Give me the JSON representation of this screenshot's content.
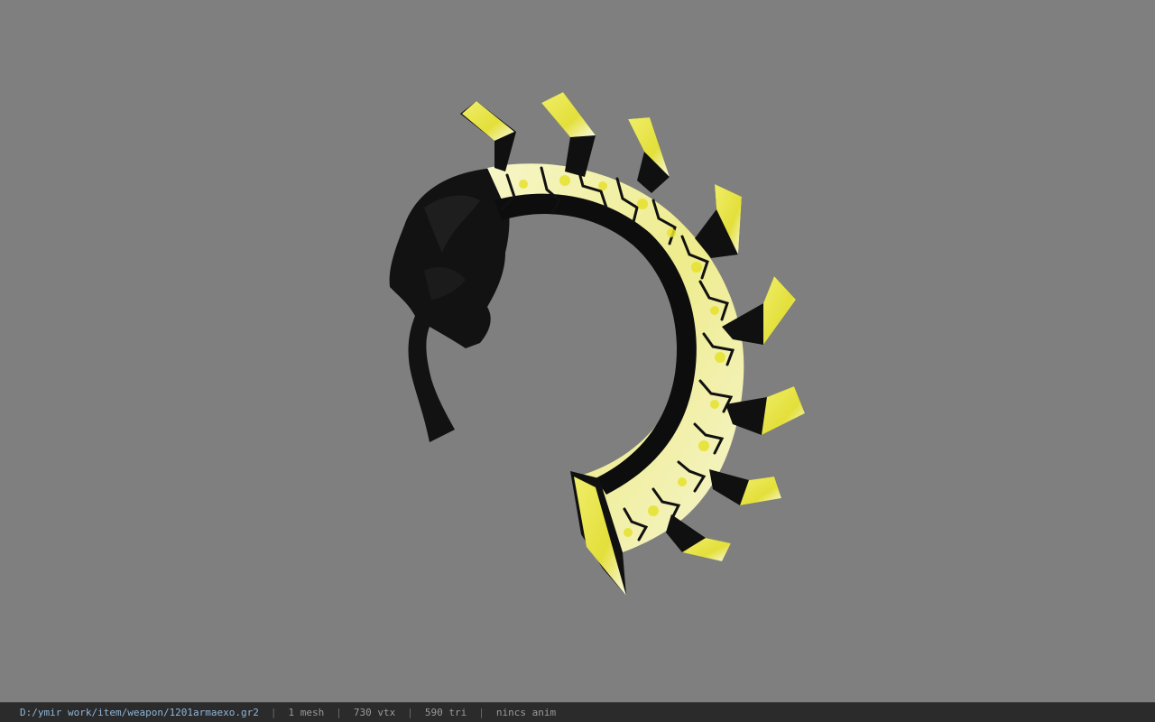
{
  "viewport": {
    "background": "#7f7f7f",
    "model": {
      "description": "yellow-and-black spiked crescent claw weapon",
      "colors": {
        "blade_light": "#f4f3c0",
        "blade_yellow": "#e8e54a",
        "edge_dark": "#0d0d0d",
        "cape_black": "#141414"
      }
    }
  },
  "status": {
    "file_path": "D:/ymir work/item/weapon/1201armaexo.gr2",
    "separator": "|",
    "mesh": "1 mesh",
    "vertices": "730 vtx",
    "triangles": "590 tri",
    "animation": "nincs anim"
  }
}
